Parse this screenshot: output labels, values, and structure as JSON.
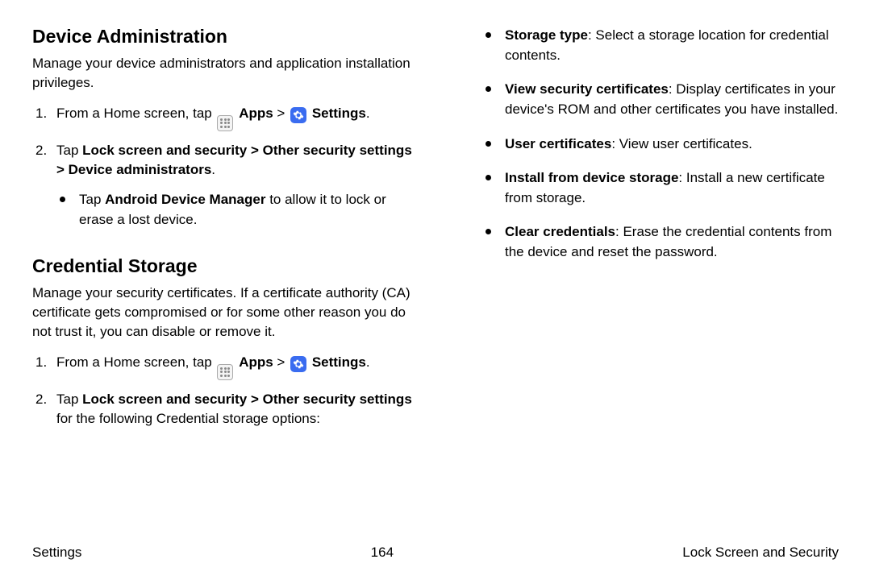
{
  "left": {
    "section1": {
      "title": "Device Administration",
      "desc": "Manage your device administrators and application installation privileges.",
      "step1_prefix": "From a Home screen, tap ",
      "step1_apps": "Apps",
      "step1_sep": " > ",
      "step1_settings": "Settings",
      "step1_suffix": ".",
      "step2_prefix": "Tap ",
      "step2_bold": "Lock screen and security > Other security settings > Device administrators",
      "step2_suffix": ".",
      "sub1_prefix": "Tap ",
      "sub1_bold": "Android Device Manager",
      "sub1_rest": " to allow it to lock or erase a lost device."
    },
    "section2": {
      "title": "Credential Storage",
      "desc": "Manage your security certificates. If a certificate authority (CA) certificate gets compromised or for some other reason you do not trust it, you can disable or remove it.",
      "step1_prefix": "From a Home screen, tap ",
      "step1_apps": "Apps",
      "step1_sep": " > ",
      "step1_settings": "Settings",
      "step1_suffix": ".",
      "step2_prefix": "Tap ",
      "step2_bold": "Lock screen and security > Other security settings",
      "step2_rest": " for the following Credential storage options:"
    }
  },
  "right": {
    "items": [
      {
        "bold": "Storage type",
        "rest": ": Select a storage location for credential contents."
      },
      {
        "bold": "View security certificates",
        "rest": ": Display certificates in your device's ROM and other certificates you have installed."
      },
      {
        "bold": "User certificates",
        "rest": ": View user certificates."
      },
      {
        "bold": "Install from device storage",
        "rest": ": Install a new certificate from storage."
      },
      {
        "bold": "Clear credentials",
        "rest": ": Erase the credential contents from the device and reset the password."
      }
    ]
  },
  "footer": {
    "left": "Settings",
    "center": "164",
    "right": "Lock Screen and Security"
  }
}
